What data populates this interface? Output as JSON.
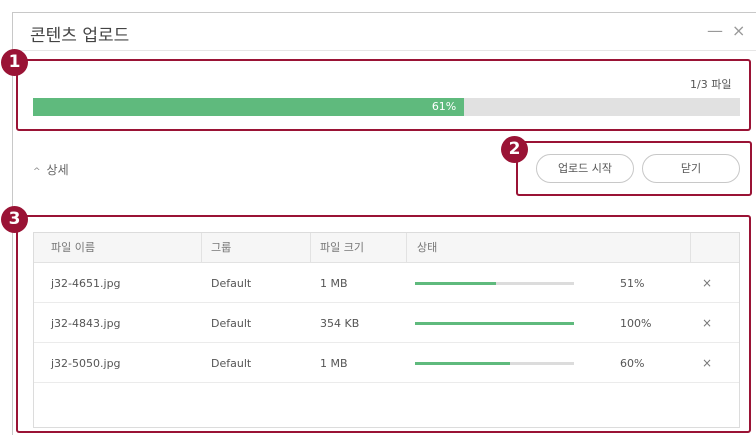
{
  "window": {
    "title": "콘텐츠 업로드",
    "minimize_icon": "—",
    "close_icon": "×"
  },
  "callouts": [
    "1",
    "2",
    "3"
  ],
  "progress": {
    "file_count": "1/3 파일",
    "percent_label": "61%",
    "fraction": 0.61,
    "color": "#5fba7d"
  },
  "detail": {
    "chevron": "^",
    "label": "상세"
  },
  "buttons": {
    "upload": "업로드 시작",
    "close": "닫기"
  },
  "table": {
    "headers": [
      "파일 이름",
      "그룹",
      "파일 크기",
      "상태"
    ],
    "rows": [
      {
        "name": "j32-4651.jpg",
        "group": "Default",
        "size": "1 MB",
        "progress": 0.51,
        "percent": "51%",
        "remove": "×"
      },
      {
        "name": "j32-4843.jpg",
        "group": "Default",
        "size": "354 KB",
        "progress": 1.0,
        "percent": "100%",
        "remove": "×"
      },
      {
        "name": "j32-5050.jpg",
        "group": "Default",
        "size": "1 MB",
        "progress": 0.6,
        "percent": "60%",
        "remove": "×"
      }
    ]
  },
  "colors": {
    "accent": "#5fba7d",
    "callout": "#9a1335"
  }
}
